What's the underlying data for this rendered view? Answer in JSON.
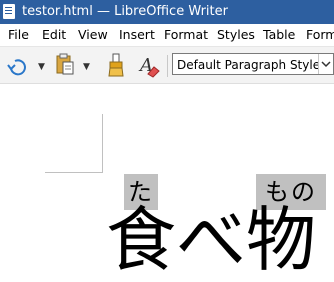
{
  "window": {
    "title": "testor.html — LibreOffice Writer"
  },
  "menu": [
    "File",
    "Edit",
    "View",
    "Insert",
    "Format",
    "Styles",
    "Table",
    "Form"
  ],
  "toolbar": {
    "paragraph_style": "Default Paragraph Style"
  },
  "document": {
    "ruby_ta": "た",
    "ruby_mono": "もの",
    "base_text": "食べ物"
  },
  "colors": {
    "titlebar": "#2d5fa0",
    "ruby_highlight": "#c0c0c0",
    "toolbar": "#f3f3f3"
  },
  "icons": [
    "writer-app-icon",
    "undo-icon",
    "paste-icon",
    "clone-formatting-icon",
    "clear-formatting-icon",
    "chevron-down-icon"
  ]
}
